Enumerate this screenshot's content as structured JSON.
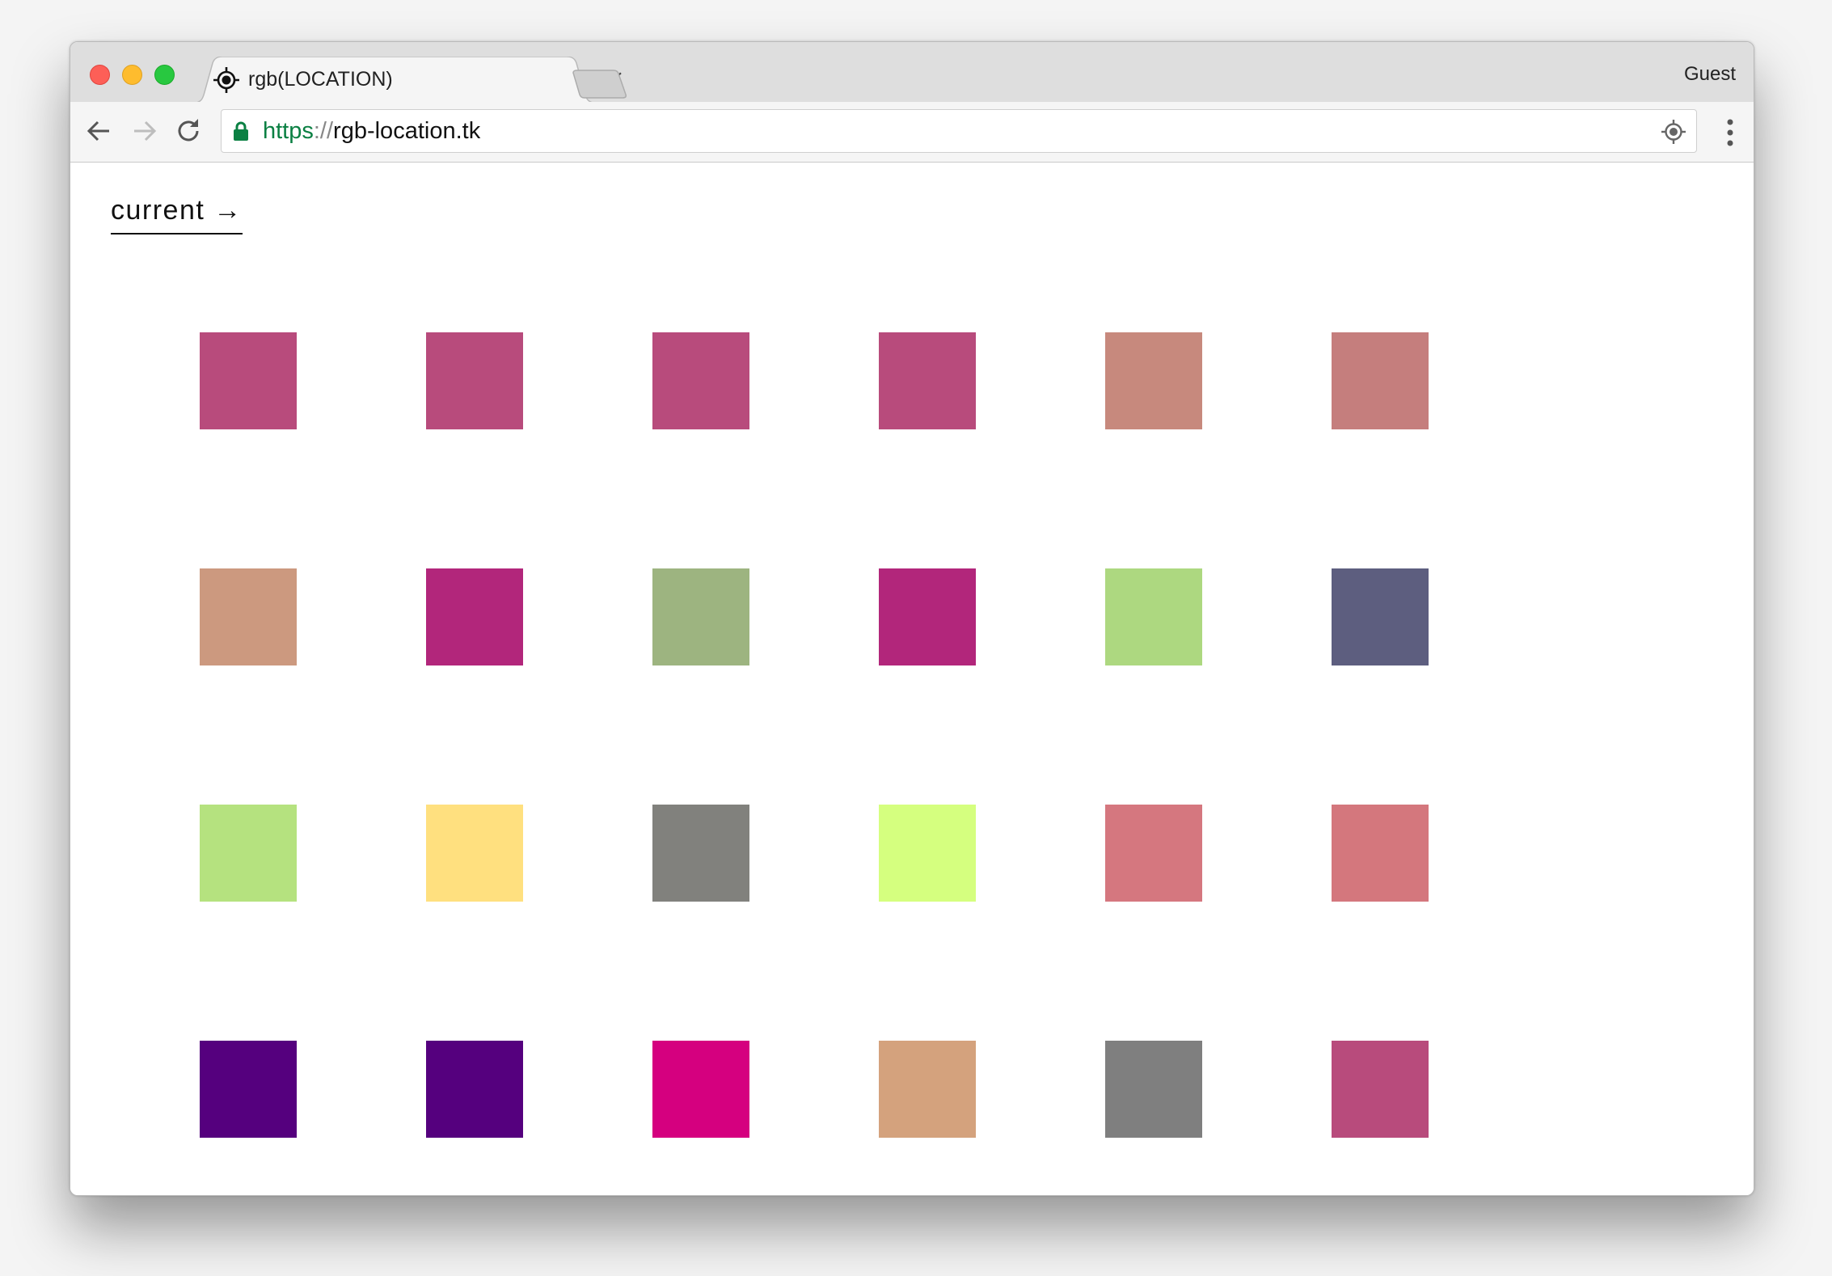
{
  "tab": {
    "title": "rgb(LOCATION)",
    "close_glyph": "×",
    "icon": "location-target-icon"
  },
  "profile": {
    "label": "Guest"
  },
  "address_bar": {
    "scheme": "https",
    "separator": "://",
    "host": "rgb-location.tk",
    "secure": true
  },
  "page": {
    "link_label": "current →"
  },
  "swatches": [
    [
      "#b84b7c",
      "#b84b7c",
      "#b84b7c",
      "#b84b7c",
      "#c7897d",
      "#c57e7d"
    ],
    [
      "#cc997f",
      "#b2267b",
      "#9db480",
      "#b2267b",
      "#add880",
      "#5d5e7f"
    ],
    [
      "#b5e27f",
      "#ffe07f",
      "#81817d",
      "#d5ff7f",
      "#d5777f",
      "#d4777d"
    ],
    [
      "#55007e",
      "#55007e",
      "#d5007f",
      "#d4a27d",
      "#7f7f7f",
      "#b84b7c"
    ]
  ]
}
